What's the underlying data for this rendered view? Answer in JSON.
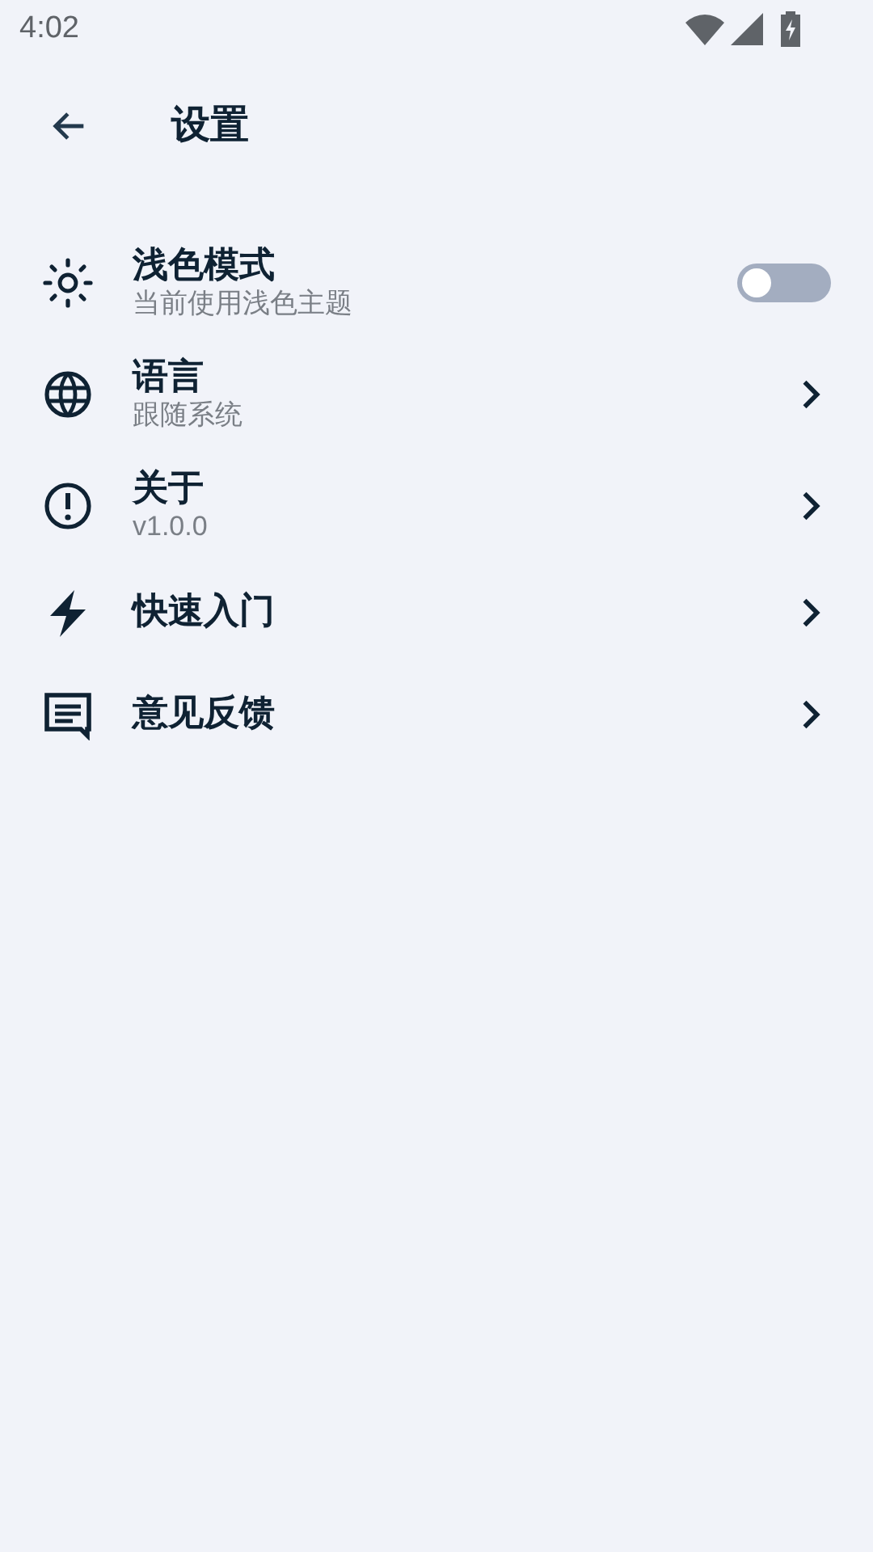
{
  "status_bar": {
    "time": "4:02"
  },
  "header": {
    "title": "设置"
  },
  "items": [
    {
      "kind": "toggle",
      "title": "浅色模式",
      "subtitle": "当前使用浅色主题",
      "on": false
    },
    {
      "kind": "link",
      "title": "语言",
      "subtitle": "跟随系统"
    },
    {
      "kind": "link",
      "title": "关于",
      "subtitle": "v1.0.0"
    },
    {
      "kind": "link",
      "title": "快速入门"
    },
    {
      "kind": "link",
      "title": "意见反馈"
    }
  ]
}
